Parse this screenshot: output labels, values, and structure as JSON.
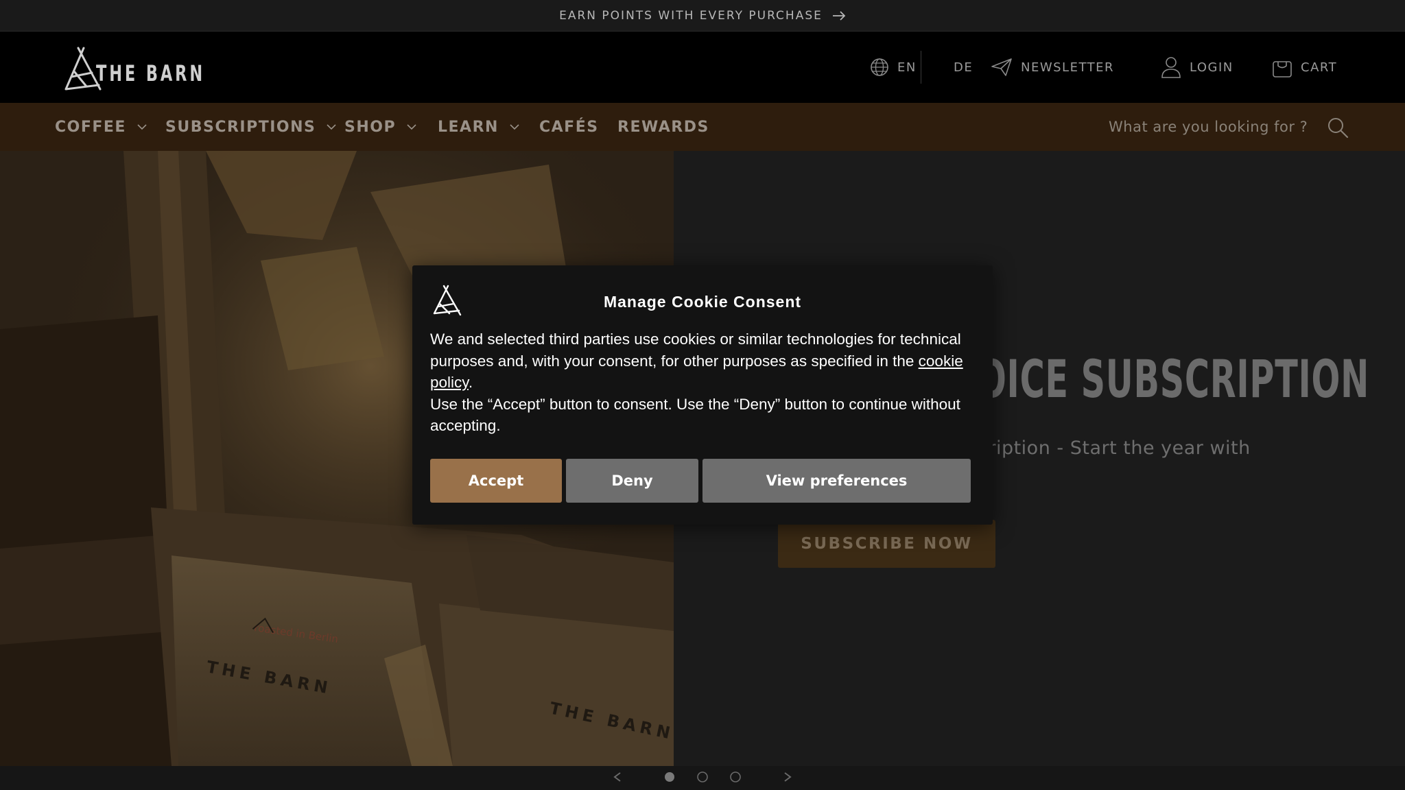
{
  "announcement": {
    "text": "EARN POINTS WITH EVERY PURCHASE"
  },
  "header": {
    "logo_text": "THE BARN",
    "language_current": "EN",
    "language_alt": "DE",
    "newsletter_label": "NEWSLETTER",
    "login_label": "LOGIN",
    "cart_label": "CART"
  },
  "nav": {
    "items": [
      {
        "label": "COFFEE",
        "has_dropdown": true
      },
      {
        "label": "SUBSCRIPTIONS",
        "has_dropdown": true
      },
      {
        "label": "SHOP",
        "has_dropdown": true
      },
      {
        "label": "LEARN",
        "has_dropdown": true
      },
      {
        "label": "CAFÉS",
        "has_dropdown": false
      },
      {
        "label": "REWARDS",
        "has_dropdown": false
      }
    ],
    "search_placeholder": "What are you looking for ?"
  },
  "hero": {
    "title_visible": "OICE SUBSCRIPTION",
    "subtitle_visible": "cription - Start the year with",
    "cta_label": "SUBSCRIBE NOW",
    "image_label": "THE BARN",
    "image_caption": "roasted in Berlin"
  },
  "cookie_modal": {
    "title": "Manage Cookie Consent",
    "body_part1": "We and selected third parties use cookies or similar technologies for technical purposes and, with your consent, for other purposes as specified in the ",
    "body_link": "cookie policy",
    "body_part2": ".",
    "body_part3": "Use the “Accept” button to consent. Use the “Deny” button to continue without accepting.",
    "accept_label": "Accept",
    "deny_label": "Deny",
    "prefs_label": "View preferences"
  },
  "colors": {
    "nav_bg": "#2e1d0d",
    "accent": "#99714a",
    "secondary_button": "#6e6e6e",
    "modal_bg": "#131313"
  },
  "icons": [
    "arrow-right-icon",
    "globe-icon",
    "paper-plane-icon",
    "user-icon",
    "shopping-bag-icon",
    "chevron-down-icon",
    "search-icon",
    "logo-mark-icon"
  ]
}
